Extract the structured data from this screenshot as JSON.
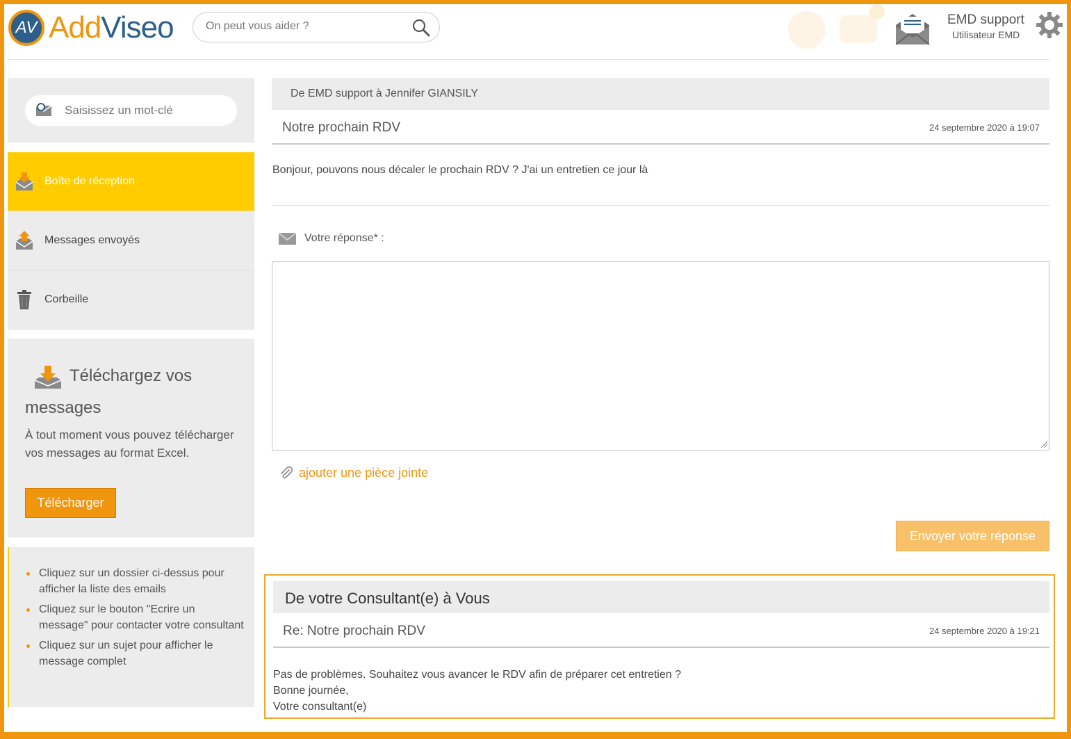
{
  "header": {
    "logo_mark": "AV",
    "logo_add": "Add",
    "logo_viseo": "Viseo",
    "search_placeholder": "On peut vous aider ?",
    "user_name": "EMD support",
    "user_role": "Utilisateur EMD",
    "icons": [
      "search-icon",
      "mail-icon",
      "gear-icon"
    ]
  },
  "sidebar": {
    "search_placeholder": "Saisissez un mot-clé",
    "folders": [
      {
        "label": "Boîte de réception",
        "icon": "inbox-download-icon",
        "active": true
      },
      {
        "label": "Messages envoyés",
        "icon": "outbox-upload-icon",
        "active": false
      },
      {
        "label": "Corbeille",
        "icon": "trash-icon",
        "active": false
      }
    ],
    "download": {
      "title_line1": "Téléchargez vos",
      "title_line2": "messages",
      "text": "À tout moment vous pouvez télécharger vos messages au format Excel.",
      "button": "Télécharger"
    },
    "help": [
      "Cliquez sur un dossier ci-dessus pour afficher la liste des emails",
      "Cliquez sur le bouton \"Ecrire un message\" pour contacter votre consultant",
      "Cliquez sur un sujet pour afficher le message complet"
    ]
  },
  "message": {
    "from_to": "De EMD support à Jennifer GIANSILY",
    "subject": "Notre prochain RDV",
    "date": "24 septembre 2020 à 19:07",
    "body": "Bonjour, pouvons nous décaler le prochain RDV ? J'ai un entretien ce jour là"
  },
  "reply_form": {
    "label": "Votre réponse* :",
    "value": "",
    "attach_label": "ajouter une pièce jointe",
    "send_button": "Envoyer votre réponse"
  },
  "reply": {
    "from_to": "De votre Consultant(e) à Vous",
    "subject": "Re: Notre prochain RDV",
    "date": "24 septembre 2020 à 19:21",
    "body_lines": [
      "Pas de problèmes. Souhaitez vous avancer le RDV afin de préparer cet entretien ?",
      "Bonne journée,",
      "Votre consultant(e)"
    ]
  },
  "colors": {
    "accent_orange": "#f0950e",
    "active_yellow": "#ffcc00",
    "brand_blue": "#2d5f8b",
    "panel_gray": "#ececec"
  }
}
